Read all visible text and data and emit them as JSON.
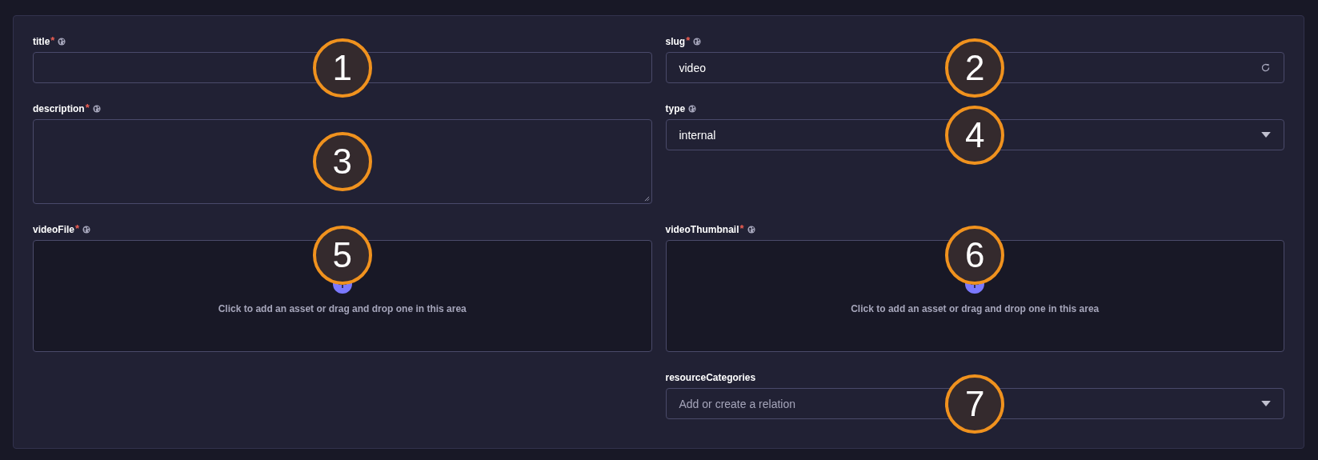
{
  "rows": [
    {
      "left": {
        "kind": "text",
        "label": "title",
        "required_mark": "*",
        "localized": true,
        "callout": "1"
      },
      "right": {
        "kind": "slug",
        "label": "slug",
        "required_mark": "*",
        "localized": true,
        "value": "video",
        "callout": "2"
      }
    },
    {
      "left": {
        "kind": "textarea",
        "label": "description",
        "required_mark": "*",
        "localized": true,
        "callout": "3"
      },
      "right": {
        "kind": "select",
        "label": "type",
        "localized": true,
        "value": "internal",
        "callout": "4"
      }
    },
    {
      "left": {
        "kind": "media",
        "label": "videoFile",
        "required_mark": "*",
        "localized": true,
        "hint": "Click to add an asset or drag and drop one in this area",
        "callout": "5"
      },
      "right": {
        "kind": "media",
        "label": "videoThumbnail",
        "required_mark": "*",
        "localized": true,
        "hint": "Click to add an asset or drag and drop one in this area",
        "callout": "6"
      }
    },
    {
      "right": {
        "kind": "relation",
        "label": "resourceCategories",
        "placeholder": "Add or create a relation",
        "callout": "7"
      }
    }
  ]
}
